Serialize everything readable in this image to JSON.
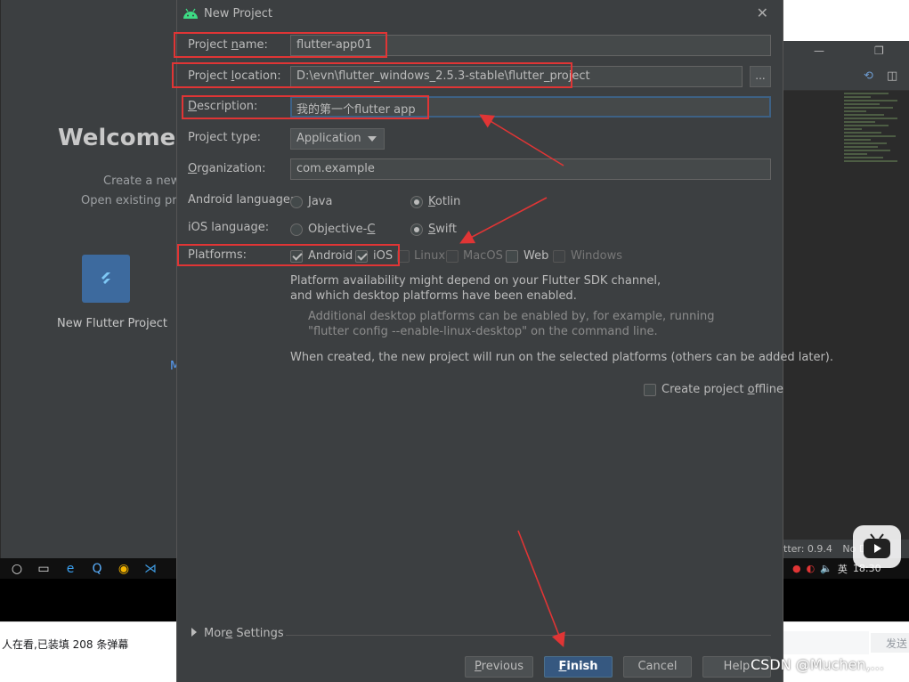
{
  "background": {
    "welcome_title": "Welcome t",
    "line1": "Create a new",
    "line2": "Open existing proj",
    "new_flutter_project": "New Flutter Project",
    "m_link": "M",
    "status_version": "tter: 0.9.4",
    "status_devices": "No Dev",
    "taskbar_clock": "18:30",
    "taskbar_lang": "英"
  },
  "web": {
    "viewer_text": "人在看,已装填 208 条弹幕",
    "send_label": "发送"
  },
  "dialog": {
    "title": "New Project",
    "project_name": {
      "label": "Project name:",
      "value": "flutter-app01"
    },
    "project_location": {
      "label": "Project location:",
      "value": "D:\\evn\\flutter_windows_2.5.3-stable\\flutter_project",
      "browse": "..."
    },
    "description": {
      "label": "Description:",
      "value": "我的第一个flutter app"
    },
    "project_type": {
      "label": "Project type:",
      "value": "Application"
    },
    "organization": {
      "label": "Organization:",
      "value": "com.example"
    },
    "android_language": {
      "label": "Android language:",
      "options": [
        "Java",
        "Kotlin"
      ],
      "selected": "Kotlin"
    },
    "ios_language": {
      "label": "iOS language:",
      "options": [
        "Objective-C",
        "Swift"
      ],
      "selected": "Swift"
    },
    "platforms": {
      "label": "Platforms:",
      "items": [
        {
          "name": "Android",
          "checked": true,
          "enabled": true
        },
        {
          "name": "iOS",
          "checked": true,
          "enabled": true
        },
        {
          "name": "Linux",
          "checked": false,
          "enabled": false
        },
        {
          "name": "MacOS",
          "checked": false,
          "enabled": false
        },
        {
          "name": "Web",
          "checked": false,
          "enabled": true
        },
        {
          "name": "Windows",
          "checked": false,
          "enabled": false
        }
      ]
    },
    "info": {
      "line1": "Platform availability might depend on your Flutter SDK channel,",
      "line2": "and which desktop platforms have been enabled.",
      "hint1": "Additional desktop platforms can be enabled by, for example, running",
      "hint2": "\"flutter config --enable-linux-desktop\" on the command line.",
      "line3": "When created, the new project will run on the selected platforms (others can be added later)."
    },
    "offline": {
      "label": "Create project offline",
      "checked": false
    },
    "more_settings": "More Settings",
    "buttons": {
      "previous": "Previous",
      "finish": "Finish",
      "cancel": "Cancel",
      "help": "Help"
    }
  },
  "watermark": "CSDN @Muchen,..."
}
